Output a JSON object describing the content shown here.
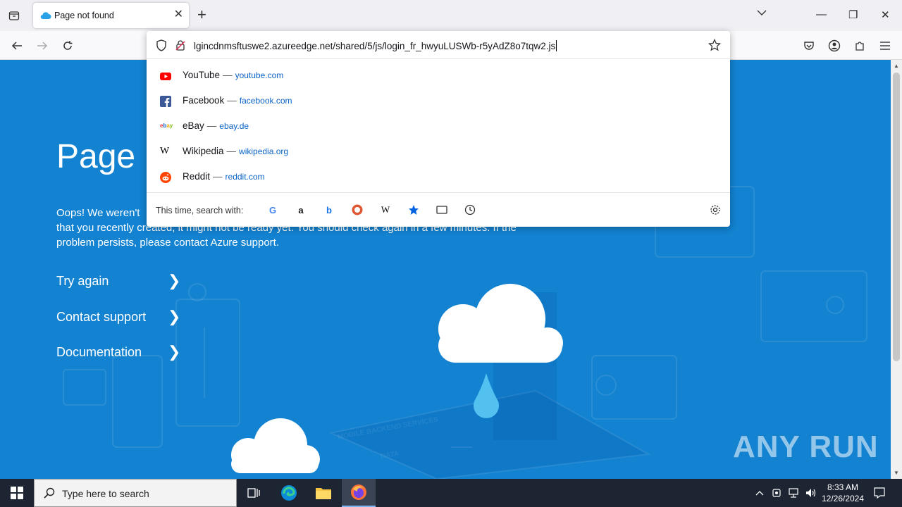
{
  "tab": {
    "title": "Page not found",
    "close": "✕"
  },
  "window": {
    "minimize": "—",
    "maximize": "❐",
    "close": "✕",
    "new_tab": "+"
  },
  "urlbar": {
    "value": "lgincdnmsftuswe2.azureedge.net/shared/5/js/login_fr_hwyuLUSWb-r5yAdZ8o7tqw2.js"
  },
  "suggestions": [
    {
      "title": "YouTube",
      "url": "youtube.com",
      "icon": "youtube-icon",
      "color": "#ff0000"
    },
    {
      "title": "Facebook",
      "url": "facebook.com",
      "icon": "facebook-icon",
      "color": "#1877f2"
    },
    {
      "title": "eBay",
      "url": "ebay.de",
      "icon": "ebay-icon",
      "color": "#e53238"
    },
    {
      "title": "Wikipedia",
      "url": "wikipedia.org",
      "icon": "wikipedia-icon",
      "color": "#000000"
    },
    {
      "title": "Reddit",
      "url": "reddit.com",
      "icon": "reddit-icon",
      "color": "#ff4500"
    }
  ],
  "separator": "—",
  "search_with": {
    "label": "This time, search with:",
    "engines": [
      "google-icon",
      "amazon-icon",
      "bing-icon",
      "duckduckgo-icon",
      "wikipedia-icon",
      "bookmarks-icon",
      "tabs-icon",
      "history-icon"
    ]
  },
  "page": {
    "heading": "Page n",
    "paragraph_line1": "Oops! We weren't",
    "paragraph_line2": "that you recently created, it might not be ready yet. You should check again in a few minutes. If the",
    "paragraph_line3": "problem persists, please contact Azure support.",
    "links": [
      "Try again",
      "Contact support",
      "Documentation"
    ],
    "background_label": "MOBILE BACKEND SERVICES",
    "background_label2": "DATA"
  },
  "taskbar": {
    "search_placeholder": "Type here to search",
    "time": "8:33 AM",
    "date": "12/26/2024"
  },
  "watermark": "ANY RUN",
  "colors": {
    "accent": "#0078d4",
    "page_bg": "#1282d1",
    "link": "#0b63c6"
  }
}
